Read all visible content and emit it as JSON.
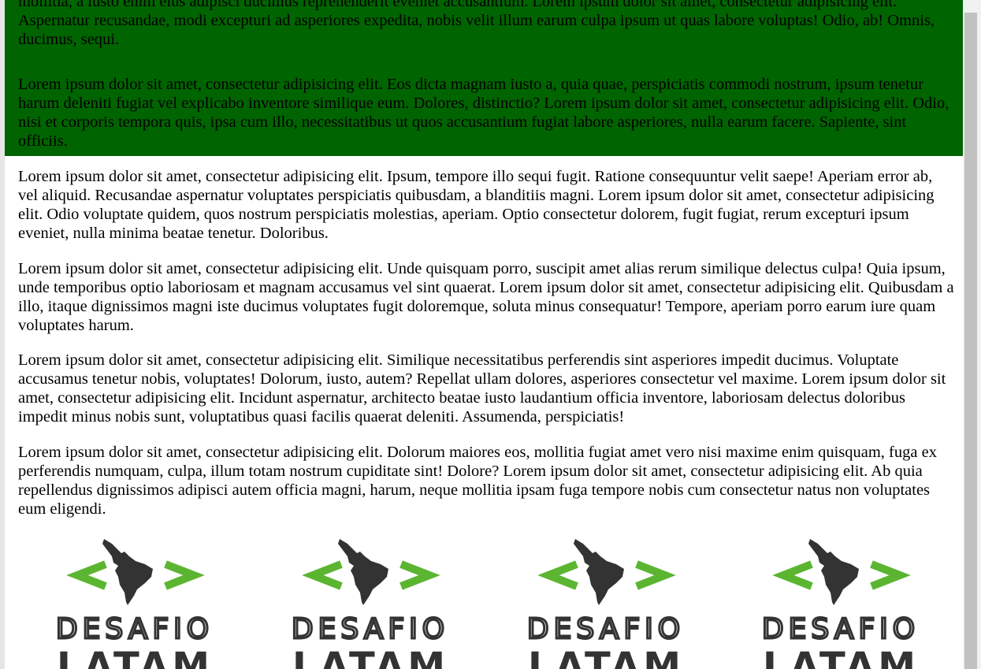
{
  "green_section": {
    "background": "#006400",
    "paragraphs": [
      "mollitia, a iusto enim eius adipisci ducimus reprehenderit eveniet accusantium. Lorem ipsum dolor sit amet, consectetur adipisicing elit. Aspernatur recusandae, modi excepturi ad asperiores expedita, nobis velit illum earum culpa ipsum ut quas labore voluptas! Odio, ab! Omnis, ducimus, sequi.",
      "Lorem ipsum dolor sit amet, consectetur adipisicing elit. Eos dicta magnam iusto a, quia quae, perspiciatis commodi nostrum, ipsum tenetur harum deleniti fugiat vel explicabo inventore similique eum. Dolores, distinctio? Lorem ipsum dolor sit amet, consectetur adipisicing elit. Odio, nisi et corporis tempora quis, ipsa cum illo, necessitatibus ut quos accusantium fugiat labore asperiores, nulla earum facere. Sapiente, sint officiis."
    ]
  },
  "white_section": {
    "paragraphs": [
      "Lorem ipsum dolor sit amet, consectetur adipisicing elit. Ipsum, tempore illo sequi fugit. Ratione consequuntur velit saepe! Aperiam error ab, vel aliquid. Recusandae aspernatur voluptates perspiciatis quibusdam, a blanditiis magni. Lorem ipsum dolor sit amet, consectetur adipisicing elit. Odio voluptate quidem, quos nostrum perspiciatis molestias, aperiam. Optio consectetur dolorem, fugit fugiat, rerum excepturi ipsum eveniet, nulla minima beatae tenetur. Doloribus.",
      "Lorem ipsum dolor sit amet, consectetur adipisicing elit. Unde quisquam porro, suscipit amet alias rerum similique delectus culpa! Quia ipsum, unde temporibus optio laboriosam et magnam accusamus vel sint quaerat. Lorem ipsum dolor sit amet, consectetur adipisicing elit. Quibusdam a illo, itaque dignissimos magni iste ducimus voluptates fugit doloremque, soluta minus consequatur! Tempore, aperiam porro earum iure quam voluptates harum.",
      "Lorem ipsum dolor sit amet, consectetur adipisicing elit. Similique necessitatibus perferendis sint asperiores impedit ducimus. Voluptate accusamus tenetur nobis, voluptates! Dolorum, iusto, autem? Repellat ullam dolores, asperiores consectetur vel maxime. Lorem ipsum dolor sit amet, consectetur adipisicing elit. Incidunt aspernatur, architecto beatae iusto laudantium officia inventore, laboriosam delectus doloribus impedit minus nobis sunt, voluptatibus quasi facilis quaerat deleniti. Assumenda, perspiciatis!",
      "Lorem ipsum dolor sit amet, consectetur adipisicing elit. Dolorum maiores eos, mollitia fugiat amet vero nisi maxime enim quisquam, fuga ex perferendis numquam, culpa, illum totam nostrum cupiditate sint! Dolore? Lorem ipsum dolor sit amet, consectetur adipisicing elit. Ab quia repellendus dignissimos adipisci autem officia magni, harum, neque mollitia ipsam fuga tempore nobis cum consectetur natus non voluptates eum eligendi."
    ]
  },
  "logos": {
    "count": 4,
    "line1": "DESAFIO",
    "line2": "LATAM",
    "bracket_color": "#5bb531",
    "dark_color": "#333333",
    "icon": "latam-map-icon"
  }
}
